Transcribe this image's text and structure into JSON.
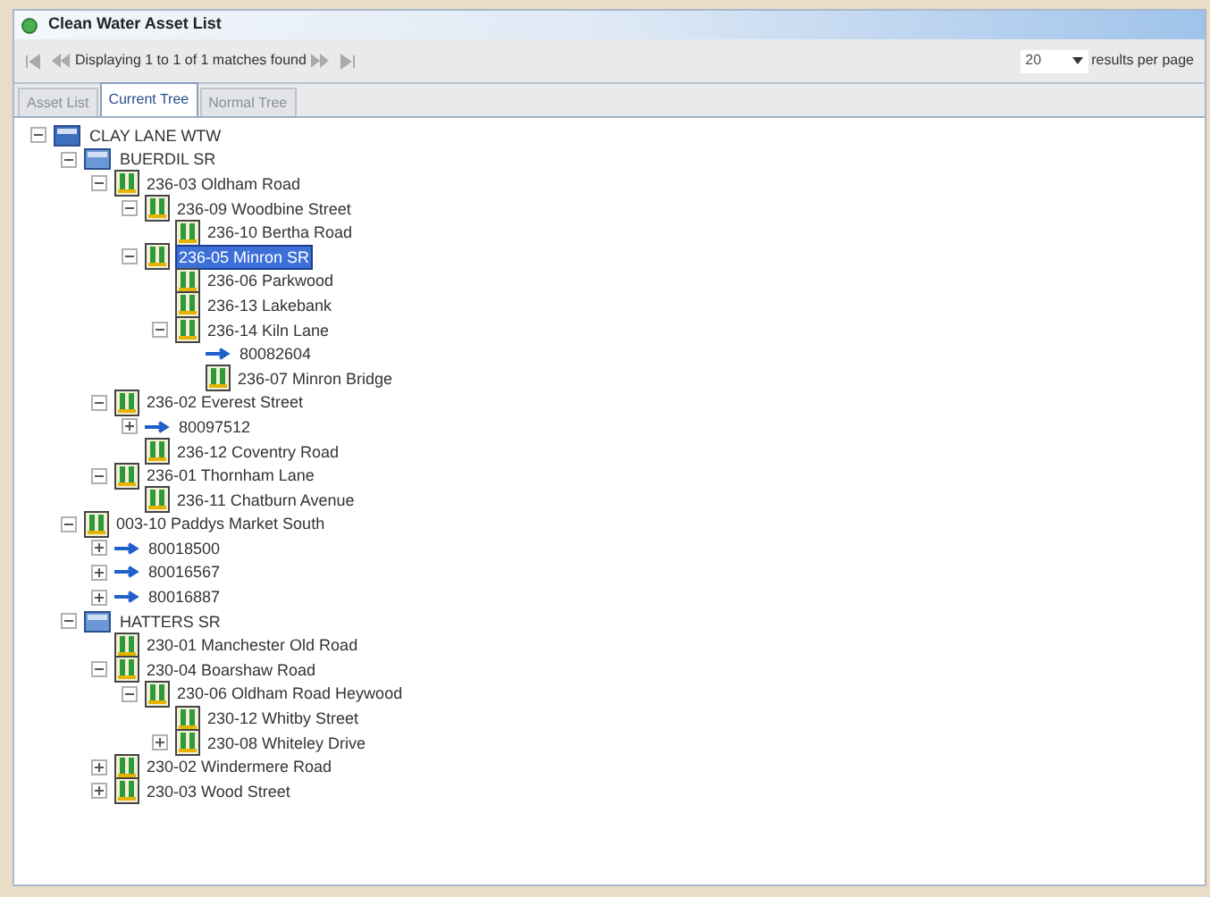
{
  "window": {
    "title": "Clean Water Asset List"
  },
  "pager": {
    "status": "Displaying 1 to 1 of 1 matches found",
    "page_size": "20",
    "page_size_label": "results per page"
  },
  "tabs": [
    {
      "label": "Asset List",
      "selected": false
    },
    {
      "label": "Current Tree",
      "selected": true
    },
    {
      "label": "Normal Tree",
      "selected": false
    }
  ],
  "tree": [
    {
      "label": "CLAY LANE WTW",
      "kind": "site",
      "expanded": true,
      "selected": false,
      "children": [
        {
          "label": "BUERDIL SR",
          "kind": "reservoir",
          "expanded": true,
          "selected": false,
          "children": [
            {
              "label": "236-03 Oldham Road",
              "kind": "station",
              "expanded": true,
              "selected": false,
              "children": [
                {
                  "label": "236-09 Woodbine Street",
                  "kind": "station",
                  "expanded": true,
                  "selected": false,
                  "children": [
                    {
                      "label": "236-10 Bertha Road",
                      "kind": "station",
                      "selected": false
                    }
                  ]
                },
                {
                  "label": "236-05 Minron SR",
                  "kind": "station",
                  "expanded": true,
                  "selected": true,
                  "children": [
                    {
                      "label": "236-06 Parkwood",
                      "kind": "station",
                      "selected": false
                    },
                    {
                      "label": "236-13 Lakebank",
                      "kind": "station",
                      "selected": false
                    },
                    {
                      "label": "236-14 Kiln Lane",
                      "kind": "station",
                      "expanded": true,
                      "selected": false,
                      "children": [
                        {
                          "label": "80082604",
                          "kind": "meter",
                          "selected": false
                        },
                        {
                          "label": "236-07 Minron Bridge",
                          "kind": "station",
                          "selected": false
                        }
                      ]
                    }
                  ]
                }
              ]
            },
            {
              "label": "236-02 Everest Street",
              "kind": "station",
              "expanded": true,
              "selected": false,
              "children": [
                {
                  "label": "80097512",
                  "kind": "meter",
                  "expanded": false,
                  "selected": false
                },
                {
                  "label": "236-12 Coventry Road",
                  "kind": "station",
                  "selected": false
                }
              ]
            },
            {
              "label": "236-01 Thornham Lane",
              "kind": "station",
              "expanded": true,
              "selected": false,
              "children": [
                {
                  "label": "236-11 Chatburn Avenue",
                  "kind": "station",
                  "selected": false
                }
              ]
            }
          ]
        },
        {
          "label": "003-10 Paddys Market South",
          "kind": "station",
          "expanded": true,
          "selected": false,
          "children": [
            {
              "label": "80018500",
              "kind": "meter",
              "expanded": false,
              "selected": false
            },
            {
              "label": "80016567",
              "kind": "meter",
              "expanded": false,
              "selected": false
            },
            {
              "label": "80016887",
              "kind": "meter",
              "expanded": false,
              "selected": false
            }
          ]
        },
        {
          "label": "HATTERS SR",
          "kind": "reservoir",
          "expanded": true,
          "selected": false,
          "children": [
            {
              "label": "230-01 Manchester Old Road",
              "kind": "station",
              "selected": false
            },
            {
              "label": "230-04 Boarshaw Road",
              "kind": "station",
              "expanded": true,
              "selected": false,
              "children": [
                {
                  "label": "230-06 Oldham Road Heywood",
                  "kind": "station",
                  "expanded": true,
                  "selected": false,
                  "children": [
                    {
                      "label": "230-12 Whitby Street",
                      "kind": "station",
                      "selected": false
                    },
                    {
                      "label": "230-08 Whiteley Drive",
                      "kind": "station",
                      "expanded": false,
                      "selected": false
                    }
                  ]
                }
              ]
            },
            {
              "label": "230-02 Windermere Road",
              "kind": "station",
              "expanded": false,
              "selected": false
            },
            {
              "label": "230-03 Wood Street",
              "kind": "station",
              "expanded": false,
              "selected": false
            }
          ]
        }
      ]
    }
  ]
}
